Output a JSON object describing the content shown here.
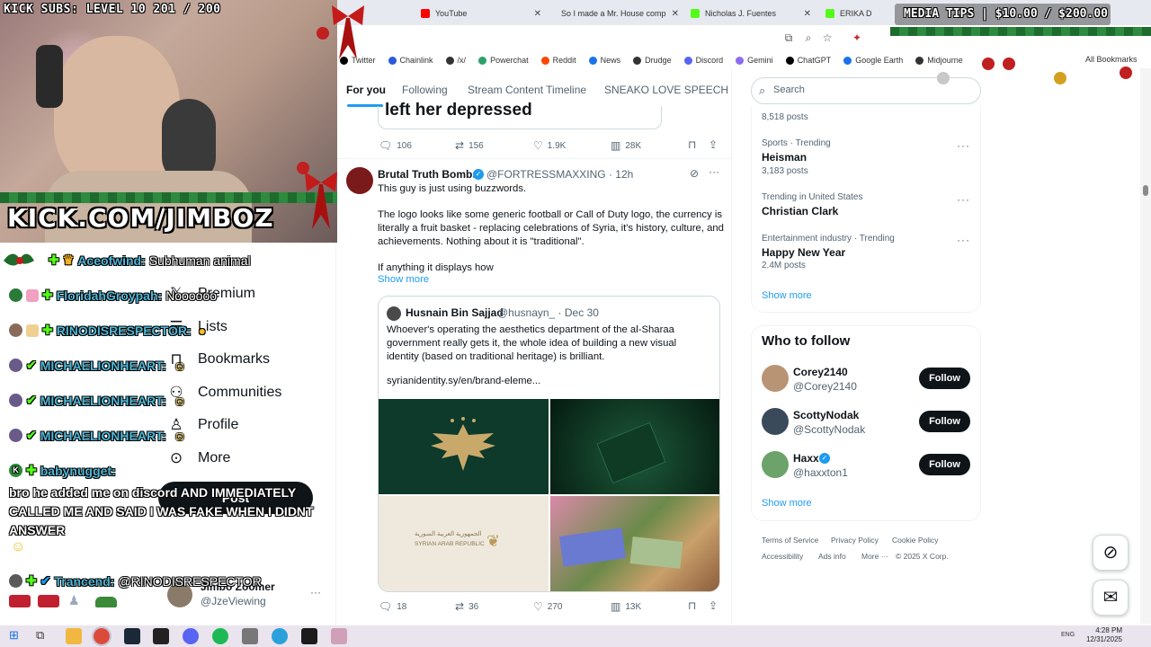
{
  "browser": {
    "tabs": [
      {
        "title": "YouTube",
        "color": "#ff0000"
      },
      {
        "title": "So I made a Mr. House comp",
        "color": "#ff0000"
      },
      {
        "title": "Nicholas J. Fuentes",
        "color": "#53fc18"
      },
      {
        "title": "ERIKA D",
        "color": "#53fc18"
      }
    ],
    "bookmarks": [
      {
        "label": "Twitter",
        "color": "#000000"
      },
      {
        "label": "Chainlink",
        "color": "#2a5ada"
      },
      {
        "label": "/x/",
        "color": "#333333"
      },
      {
        "label": "Powerchat",
        "color": "#2aa06b"
      },
      {
        "label": "Reddit",
        "color": "#ff4500"
      },
      {
        "label": "News",
        "color": "#1a73e8"
      },
      {
        "label": "Drudge",
        "color": "#333333"
      },
      {
        "label": "Discord",
        "color": "#5865f2"
      },
      {
        "label": "Gemini",
        "color": "#8e6cef"
      },
      {
        "label": "ChatGPT",
        "color": "#000000"
      },
      {
        "label": "Google Earth",
        "color": "#1a73e8"
      },
      {
        "label": "Midjourne",
        "color": "#333333"
      }
    ],
    "all_bookmarks": "All Bookmarks"
  },
  "stream": {
    "kick_subs": "KICK SUBS: LEVEL 10 201 / 200",
    "kick_url": "KICK.COM/JIMBOZ",
    "media_tips": "MEDIA TIPS | $10.00 / $200.00"
  },
  "chat": [
    {
      "user": "Aceofwind:",
      "message": "Subhuman animal"
    },
    {
      "user": "FloridahGroypah:",
      "message": "Noooooo"
    },
    {
      "user": "RINODISRESPECTOR:",
      "message": ""
    },
    {
      "user": "MICHAELIONHEART:",
      "message": ""
    },
    {
      "user": "MICHAELIONHEART:",
      "message": ""
    },
    {
      "user": "MICHAELIONHEART:",
      "message": ""
    },
    {
      "user": "babynugget:",
      "message": "bro he added me on discord AND IMMEDIATELY CALLED ME AND SAID I WAS FAKE WHEN I DIDNT ANSWER"
    },
    {
      "user": "Trancend:",
      "message": "@RINODISRESPECTOR"
    }
  ],
  "x_nav": {
    "items": [
      "Premium",
      "Lists",
      "Bookmarks",
      "Communities",
      "Profile",
      "More"
    ],
    "post": "Post",
    "account_name": "Jimbo Zoomer",
    "account_handle": "@JzeViewing"
  },
  "feed": {
    "tabs": [
      "For you",
      "Following",
      "Stream Content Timeline",
      "SNEAKO LOVE SPEECH"
    ],
    "prev_tweet_tail": "left her depressed",
    "prev_stats": {
      "replies": "106",
      "reposts": "156",
      "likes": "1.9K",
      "views": "28K"
    },
    "tweet": {
      "name": "Brutal Truth Bombs",
      "handle": "@FORTRESSMAXXING · 12h",
      "p1": "This guy is just using buzzwords.",
      "p2": "The logo looks like some generic football or Call of Duty logo, the currency is literally a fruit basket - replacing celebrations of Syria, it's history, culture, and achievements. Nothing about it is \"traditional\".",
      "p3": "If anything it displays how",
      "show_more": "Show more",
      "quote": {
        "name": "Husnain Bin Sajjad",
        "handle": "@husnayn_ · Dec 30",
        "text": "Whoever's operating the aesthetics department of the al-Sharaa government really gets it, the whole idea of building a new visual identity (based on traditional heritage) is brilliant.",
        "link": "syrianidentity.sy/en/brand-eleme...",
        "img_arabic": "الجمهورية العربية السورية",
        "img_english": "SYRIAN ARAB REPUBLIC"
      },
      "stats": {
        "replies": "18",
        "reposts": "36",
        "likes": "270",
        "views": "13K"
      }
    }
  },
  "sidebar": {
    "search_placeholder": "Search",
    "trends": [
      {
        "meta": "",
        "name": "",
        "posts": "8,518 posts"
      },
      {
        "meta": "Sports · Trending",
        "name": "Heisman",
        "posts": "3,183 posts"
      },
      {
        "meta": "Trending in United States",
        "name": "Christian Clark",
        "posts": ""
      },
      {
        "meta": "Entertainment industry · Trending",
        "name": "Happy New Year",
        "posts": "2.4M posts"
      }
    ],
    "show_more": "Show more",
    "who_to_follow": "Who to follow",
    "follow_suggestions": [
      {
        "name": "Corey2140",
        "handle": "@Corey2140",
        "color": "#b89474"
      },
      {
        "name": "ScottyNodak",
        "handle": "@ScottyNodak",
        "color": "#3a4a5a"
      },
      {
        "name": "Haxx",
        "handle": "@haxxton1",
        "color": "#6ba36b"
      }
    ],
    "follow_label": "Follow",
    "footer": [
      "Terms of Service",
      "Privacy Policy",
      "Cookie Policy",
      "Accessibility",
      "Ads info",
      "More ···",
      "© 2025 X Corp."
    ]
  },
  "taskbar": {
    "lang": "ENG",
    "time": "4:28 PM",
    "date": "12/31/2025"
  }
}
